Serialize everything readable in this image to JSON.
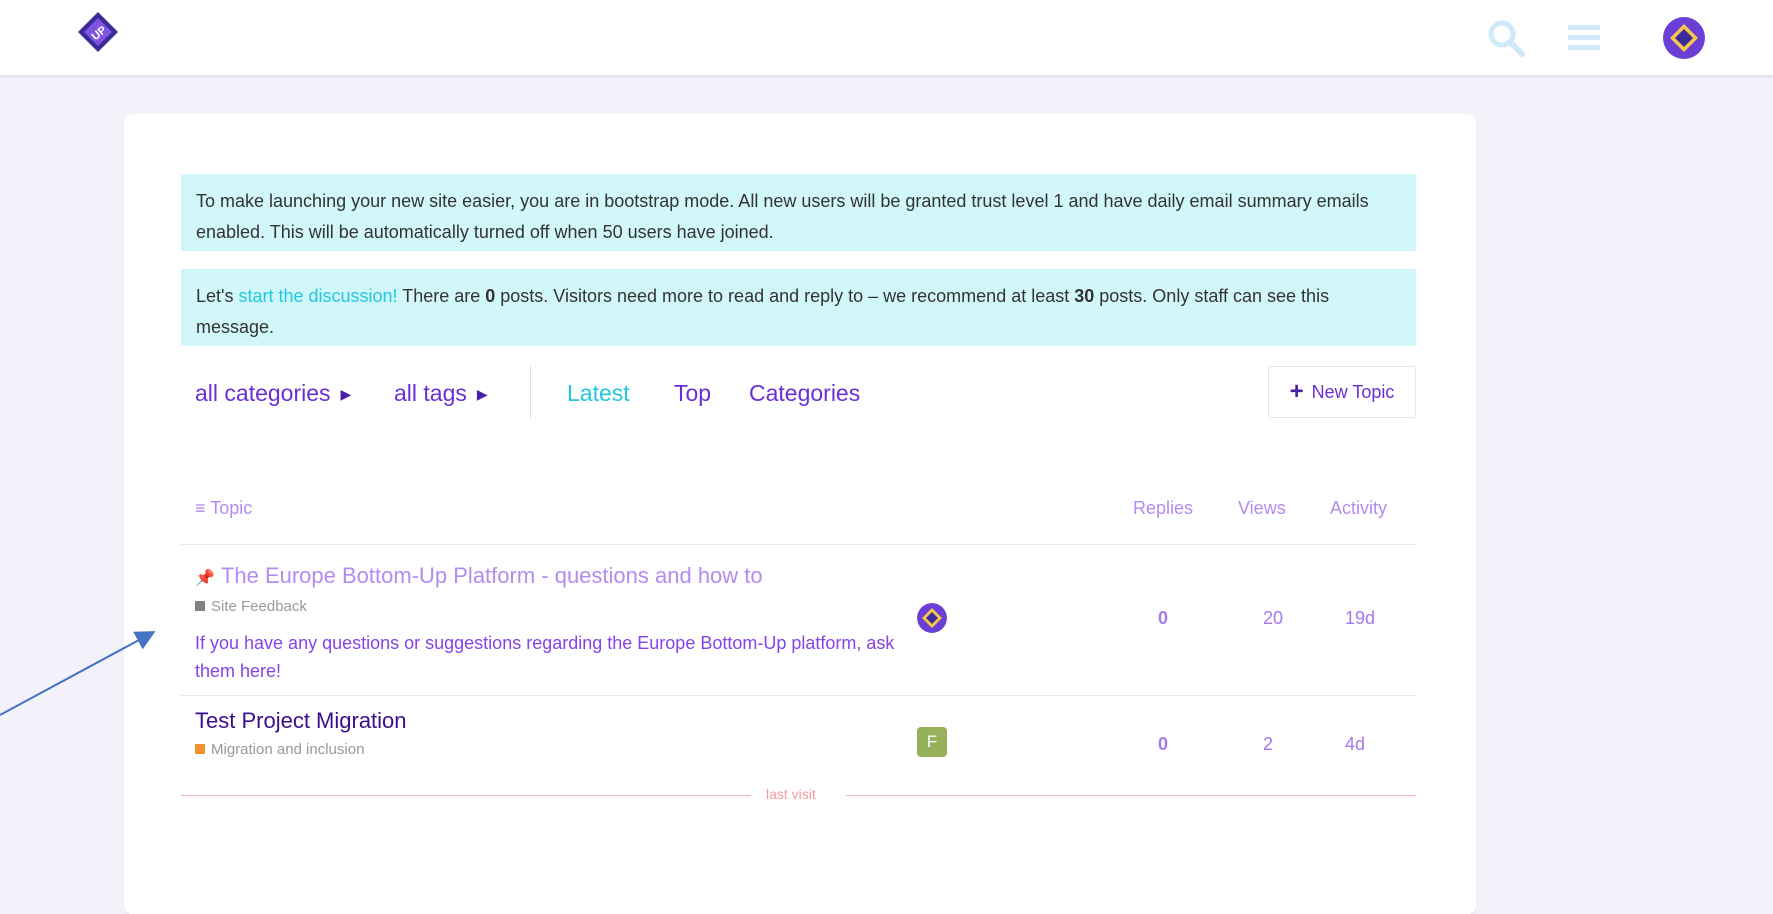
{
  "header": {
    "logo": "europe-bottom-up-logo",
    "search_icon": "search-icon",
    "menu_icon": "hamburger-menu-icon",
    "avatar": "user-avatar"
  },
  "notices": {
    "bootstrap": "To make launching your new site easier, you are in bootstrap mode. All new users will be granted trust level 1 and have daily email summary emails enabled. This will be automatically turned off when 50 users have joined.",
    "discussion_prefix": "Let's ",
    "discussion_link": "start the discussion!",
    "discussion_mid1": " There are ",
    "posts_count": "0",
    "discussion_mid2": " posts. Visitors need more to read and reply to – we recommend at least ",
    "recommended": "30",
    "discussion_suffix": " posts. Only staff can see this message."
  },
  "nav": {
    "categories": "all categories",
    "tags": "all tags",
    "tabs": [
      "Latest",
      "Top",
      "Categories"
    ],
    "new_topic": "New Topic"
  },
  "table": {
    "headers": {
      "topic": "Topic",
      "replies": "Replies",
      "views": "Views",
      "activity": "Activity"
    },
    "rows": [
      {
        "title": "The Europe Bottom-Up Platform - questions and how to",
        "category": "Site Feedback",
        "category_color": "#808281",
        "excerpt": "If you have any questions or suggestions regarding the Europe Bottom-Up platform, ask them here!",
        "poster": "logo-avatar",
        "replies": "0",
        "views": "20",
        "activity": "19d"
      },
      {
        "title": "Test Project Migration",
        "category": "Migration and inclusion",
        "category_color": "#f1902e",
        "poster_initial": "F",
        "replies": "0",
        "views": "2",
        "activity": "4d"
      }
    ],
    "last_visit": "last visit"
  }
}
